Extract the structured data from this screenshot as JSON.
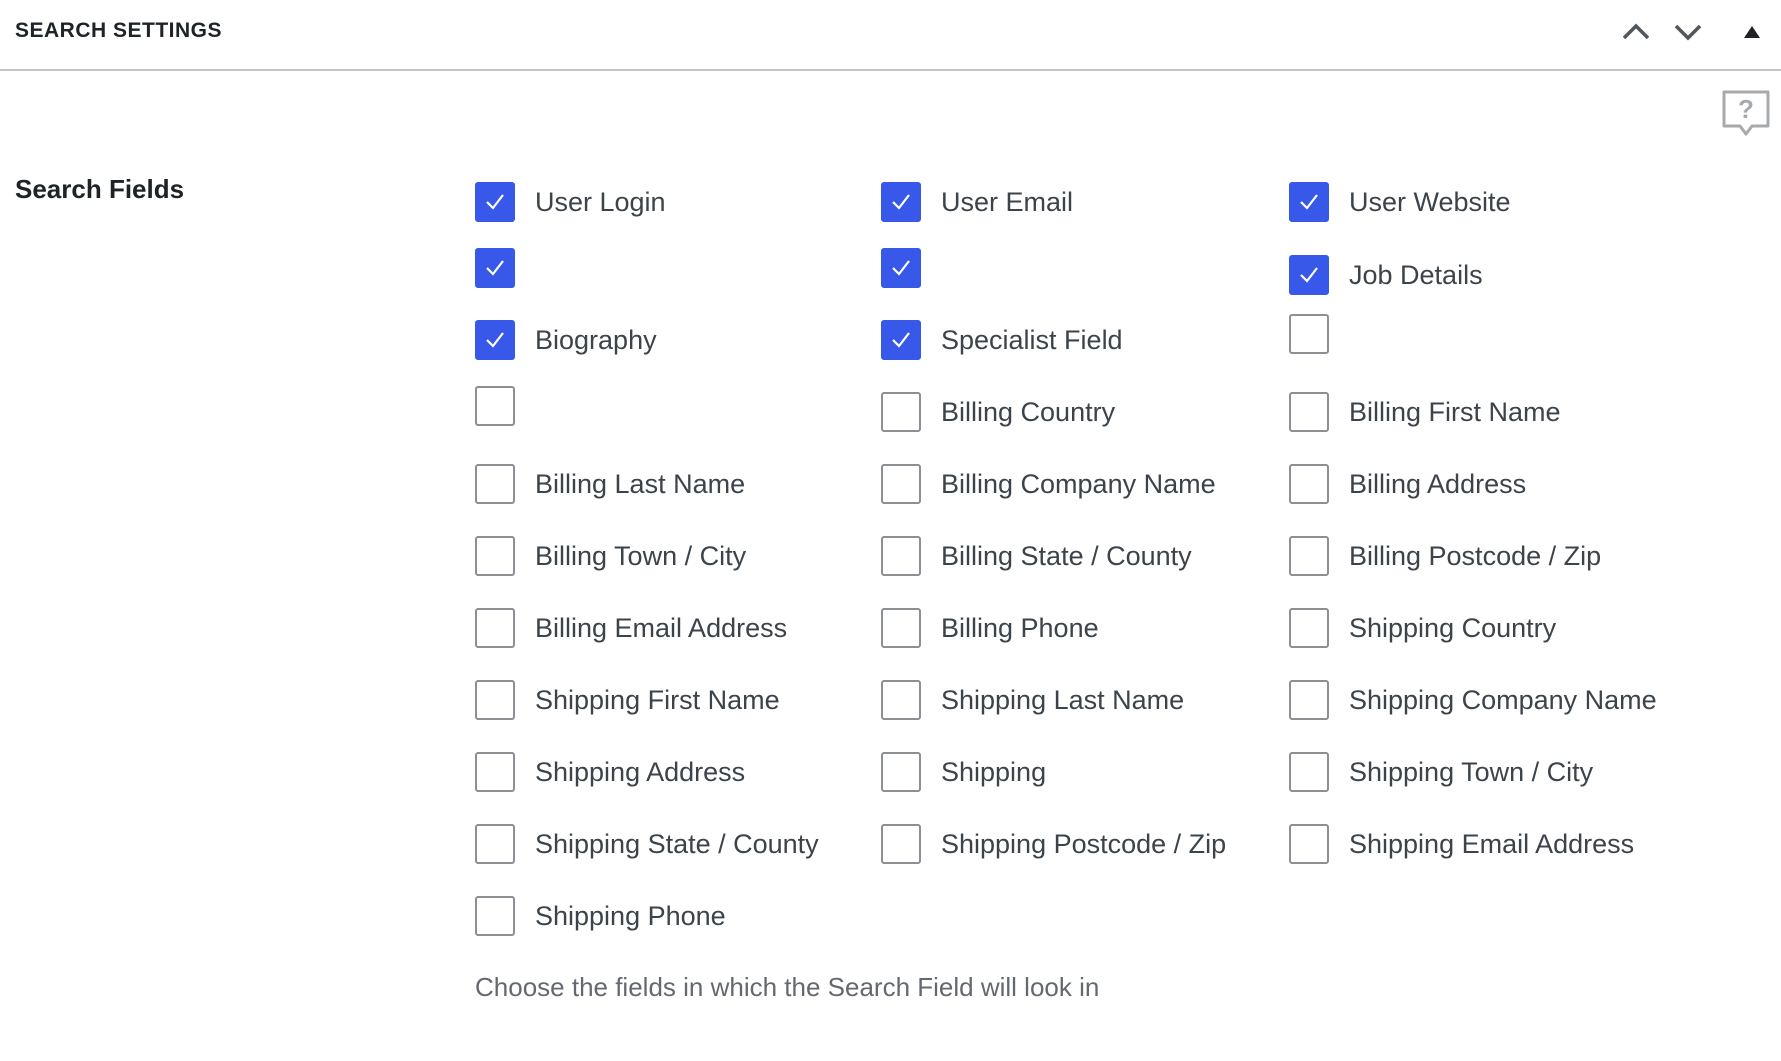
{
  "panel": {
    "title": "SEARCH SETTINGS",
    "header_icons": [
      "chevron-up-icon",
      "chevron-down-icon",
      "triangle-up-icon"
    ]
  },
  "help_icon": "help-question-icon",
  "section": {
    "label": "Search Fields",
    "description": "Choose the fields in which the Search Field will look in"
  },
  "accent_color": "#3858e9",
  "options": [
    {
      "label": "User Login",
      "checked": true
    },
    {
      "label": "User Email",
      "checked": true
    },
    {
      "label": "User Website",
      "checked": true
    },
    {
      "label": "",
      "checked": true
    },
    {
      "label": "",
      "checked": true
    },
    {
      "label": "Job Details",
      "checked": true
    },
    {
      "label": "Biography",
      "checked": true
    },
    {
      "label": "Specialist Field",
      "checked": true
    },
    {
      "label": "",
      "checked": false
    },
    {
      "label": "",
      "checked": false
    },
    {
      "label": "Billing Country",
      "checked": false
    },
    {
      "label": "Billing First Name",
      "checked": false
    },
    {
      "label": "Billing Last Name",
      "checked": false
    },
    {
      "label": "Billing Company Name",
      "checked": false
    },
    {
      "label": "Billing Address",
      "checked": false
    },
    {
      "label": "Billing Town / City",
      "checked": false
    },
    {
      "label": "Billing State / County",
      "checked": false
    },
    {
      "label": "Billing Postcode / Zip",
      "checked": false
    },
    {
      "label": "Billing Email Address",
      "checked": false
    },
    {
      "label": "Billing Phone",
      "checked": false
    },
    {
      "label": "Shipping Country",
      "checked": false
    },
    {
      "label": "Shipping First Name",
      "checked": false
    },
    {
      "label": "Shipping Last Name",
      "checked": false
    },
    {
      "label": "Shipping Company Name",
      "checked": false
    },
    {
      "label": "Shipping Address",
      "checked": false
    },
    {
      "label": "Shipping",
      "checked": false
    },
    {
      "label": "Shipping Town / City",
      "checked": false
    },
    {
      "label": "Shipping State / County",
      "checked": false
    },
    {
      "label": "Shipping Postcode / Zip",
      "checked": false
    },
    {
      "label": "Shipping Email Address",
      "checked": false
    },
    {
      "label": "Shipping Phone",
      "checked": false
    }
  ]
}
